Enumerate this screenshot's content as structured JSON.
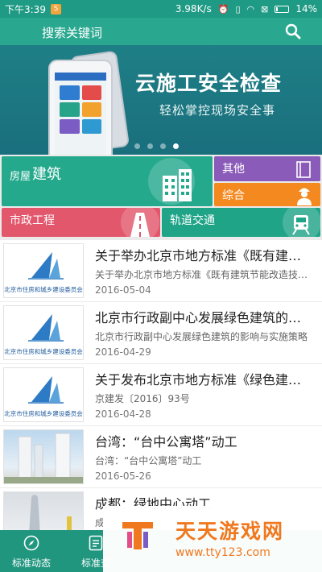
{
  "status_bar": {
    "time": "下午3:39",
    "notification": "S",
    "network_speed": "3.98K/s",
    "battery": "14%",
    "battery_level": 0.14
  },
  "header": {
    "search_hint": "搜索关键词",
    "search_icon": "search-icon"
  },
  "banner": {
    "title": "云施工安全检查",
    "subtitle": "轻松掌控现场安全事",
    "slide_count": 4,
    "active_slide": 4
  },
  "categories": {
    "building_prefix": "房屋",
    "building_label": "建筑",
    "other": "其他",
    "general": "综合",
    "municipal": "市政工程",
    "rail": "轨道交通"
  },
  "news": [
    {
      "title": "关于举办北京市地方标准《既有建筑节能改造技术规程》",
      "desc": "关于举办北京市地方标准《既有建筑节能改造技术规程》",
      "date": "2016-05-04",
      "thumb_caption": "北京市住房和城乡建设委员会"
    },
    {
      "title": "北京市行政副中心发展绿色建筑的影响与实施策略",
      "desc": "北京市行政副中心发展绿色建筑的影响与实施策略",
      "date": "2016-04-29",
      "thumb_caption": "北京市住房和城乡建设委员会"
    },
    {
      "title": "关于发布北京市地方标准《绿色建筑评价标准》",
      "desc": "京建发〔2016〕93号",
      "date": "2016-04-28",
      "thumb_caption": "北京市住房和城乡建设委员会"
    },
    {
      "title": "台湾：“台中公寓塔”动工",
      "desc": "台湾：“台中公寓塔”动工",
      "date": "2016-05-26",
      "thumb_caption": ""
    },
    {
      "title": "成都：绿地中心动工",
      "desc": "成",
      "date": "",
      "thumb_caption": ""
    }
  ],
  "bottom_nav": {
    "items": [
      {
        "label": "标准动态",
        "icon": "compass-icon"
      },
      {
        "label": "标准查",
        "icon": "document-icon"
      }
    ]
  },
  "watermark": {
    "name": "天天游戏网",
    "url": "www.tty123.com"
  }
}
